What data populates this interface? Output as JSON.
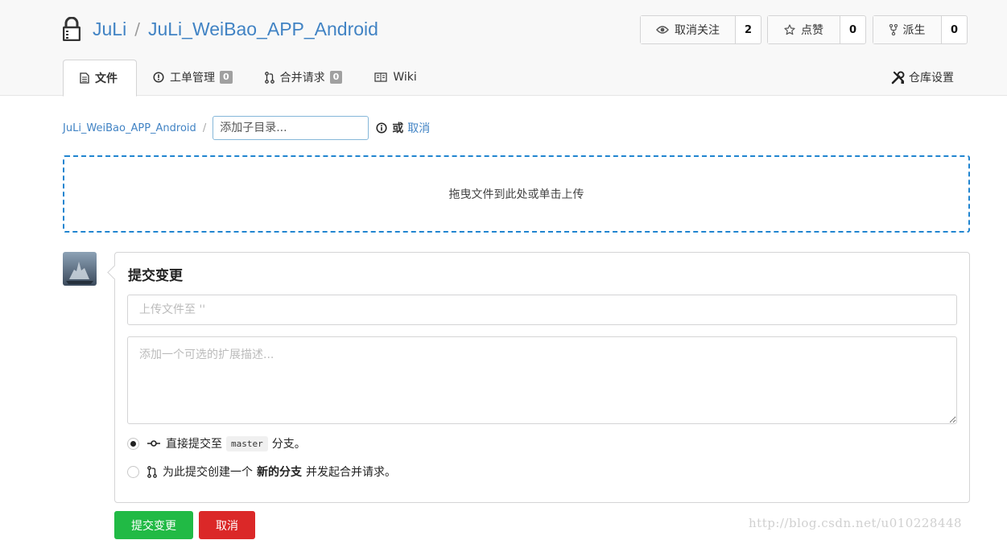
{
  "header": {
    "owner": "JuLi",
    "separator": "/",
    "repo": "JuLi_WeiBao_APP_Android",
    "lock_icon": "lock-icon",
    "watch": {
      "label": "取消关注",
      "count": "2",
      "icon": "eye-icon"
    },
    "star": {
      "label": "点赞",
      "count": "0",
      "icon": "star-icon"
    },
    "fork": {
      "label": "派生",
      "count": "0",
      "icon": "fork-icon"
    }
  },
  "tabs": {
    "files": "文件",
    "issues": "工单管理",
    "issues_count": "0",
    "pulls": "合并请求",
    "pulls_count": "0",
    "wiki": "Wiki",
    "settings": "仓库设置"
  },
  "breadcrumb": {
    "root": "JuLi_WeiBao_APP_Android",
    "slash": "/",
    "dir_placeholder": "添加子目录...",
    "or": "或",
    "cancel": "取消"
  },
  "dropzone": {
    "text": "拖曳文件到此处或单击上传"
  },
  "commit": {
    "title": "提交变更",
    "summary_placeholder": "上传文件至 ''",
    "desc_placeholder": "添加一个可选的扩展描述...",
    "direct_prefix": "直接提交至",
    "branch": "master",
    "direct_suffix": "分支。",
    "new_prefix": "为此提交创建一个",
    "new_bold": "新的分支",
    "new_suffix": "并发起合并请求。",
    "selected": "direct"
  },
  "buttons": {
    "commit": "提交变更",
    "cancel": "取消"
  },
  "colors": {
    "link": "#4183c4",
    "commit": "#21ba45",
    "cancel": "#db2828",
    "dropzone_border": "#2185d0"
  },
  "watermark": "http://blog.csdn.net/u010228448"
}
